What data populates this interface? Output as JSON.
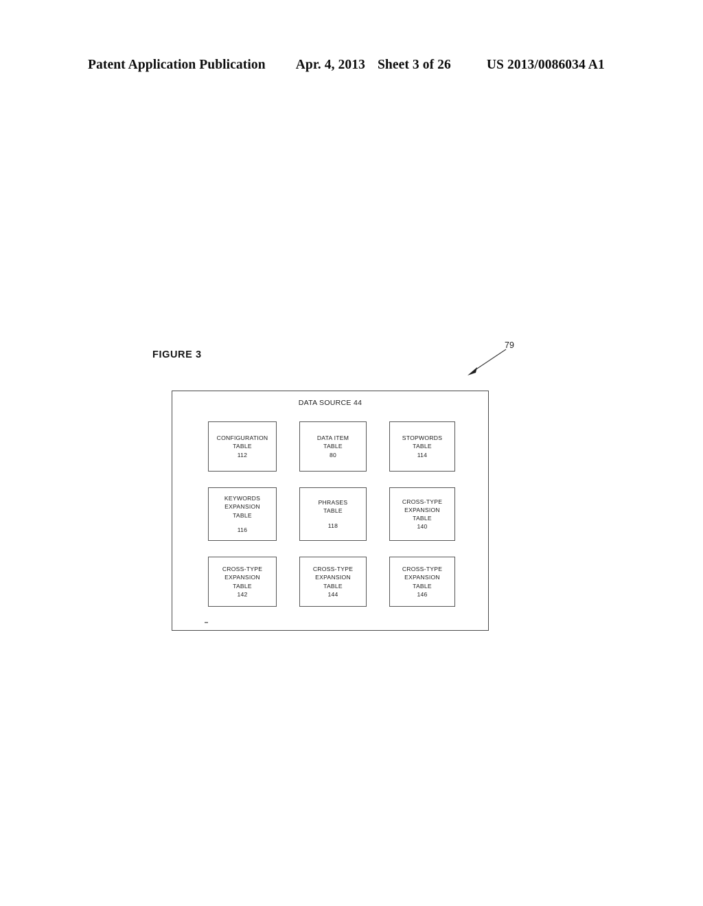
{
  "header": {
    "publication": "Patent Application Publication",
    "date": "Apr. 4, 2013",
    "sheet": "Sheet 3 of 26",
    "publication_number": "US 2013/0086034 A1"
  },
  "figure": {
    "label": "FIGURE 3",
    "reference_numeral": "79"
  },
  "diagram": {
    "container_title": "DATA SOURCE 44",
    "boxes": [
      {
        "name": "CONFIGURATION\nTABLE",
        "number": "112"
      },
      {
        "name": "DATA ITEM\nTABLE",
        "number": "80"
      },
      {
        "name": "STOPWORDS\nTABLE",
        "number": "114"
      },
      {
        "name": "KEYWORDS\nEXPANSION\nTABLE",
        "number": "116"
      },
      {
        "name": "PHRASES\nTABLE",
        "number": "118"
      },
      {
        "name": "CROSS-TYPE\nEXPANSION\nTABLE",
        "number": "140"
      },
      {
        "name": "CROSS-TYPE\nEXPANSION\nTABLE",
        "number": "142"
      },
      {
        "name": "CROSS-TYPE\nEXPANSION\nTABLE",
        "number": "144"
      },
      {
        "name": "CROSS-TYPE\nEXPANSION\nTABLE",
        "number": "146"
      }
    ]
  }
}
